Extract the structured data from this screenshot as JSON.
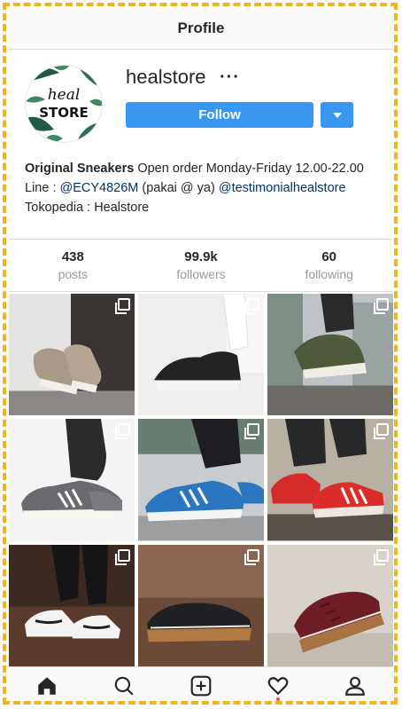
{
  "header": {
    "title": "Profile"
  },
  "profile": {
    "username": "healstore",
    "more_icon": "···",
    "follow_label": "Follow",
    "avatar_text": "STORE",
    "avatar_script": "heal"
  },
  "bio": {
    "line1_bold": "Original Sneakers",
    "line1_rest": " Open order Monday-Friday 12.00-22.00",
    "line2_prefix": "Line : ",
    "line2_id": "@ECY4826M",
    "line2_mid": " (pakai @ ya) ",
    "line2_handle": "@testimonialhealstore",
    "line3": "Tokopedia : Healstore"
  },
  "stats": [
    {
      "value": "438",
      "label": "posts"
    },
    {
      "value": "99.9k",
      "label": "followers"
    },
    {
      "value": "60",
      "label": "following"
    }
  ],
  "icons": {
    "home": "home-icon",
    "search": "search-icon",
    "add": "add-post-icon",
    "activity": "heart-icon",
    "profile": "profile-icon"
  },
  "colors": {
    "accent": "#3897f0",
    "frame": "#f2b41b",
    "link": "#003569",
    "notification": "#ed4956"
  }
}
